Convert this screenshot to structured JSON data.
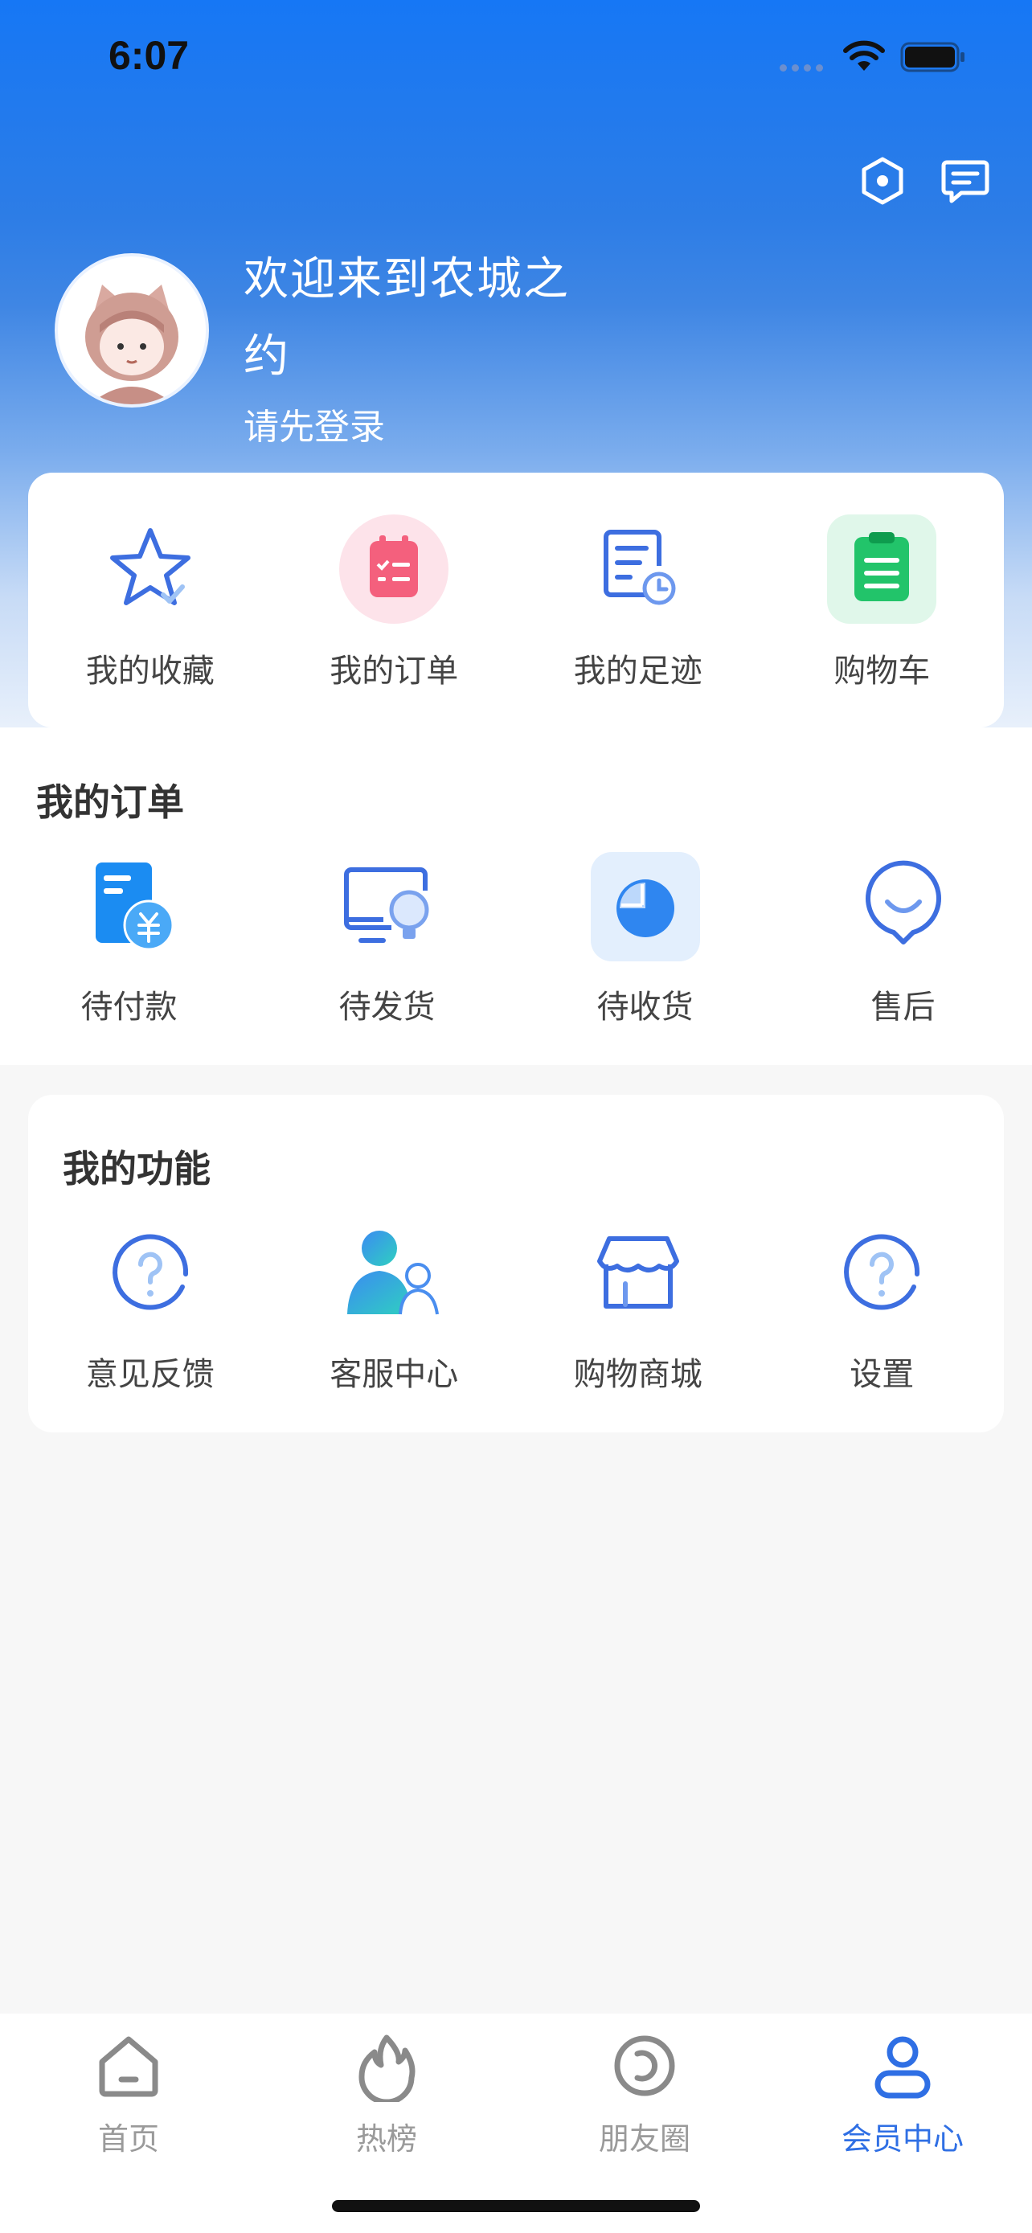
{
  "status_bar": {
    "time": "6:07"
  },
  "header": {
    "settings_icon": "hexagon-settings-icon",
    "message_icon": "message-icon",
    "welcome": "欢迎来到农城之约",
    "login_tip": "请先登录"
  },
  "quick_actions": [
    {
      "label": "我的收藏",
      "icon": "star-icon"
    },
    {
      "label": "我的订单",
      "icon": "order-list-icon"
    },
    {
      "label": "我的足迹",
      "icon": "footprint-icon"
    },
    {
      "label": "购物车",
      "icon": "clipboard-cart-icon"
    }
  ],
  "orders": {
    "title": "我的订单",
    "items": [
      {
        "label": "待付款",
        "icon": "payment-icon"
      },
      {
        "label": "待发货",
        "icon": "shipping-icon"
      },
      {
        "label": "待收货",
        "icon": "receive-icon"
      },
      {
        "label": "售后",
        "icon": "after-sales-icon"
      }
    ]
  },
  "functions": {
    "title": "我的功能",
    "items": [
      {
        "label": "意见反馈",
        "icon": "question-icon"
      },
      {
        "label": "客服中心",
        "icon": "customer-service-icon"
      },
      {
        "label": "购物商城",
        "icon": "store-icon"
      },
      {
        "label": "设置",
        "icon": "question-icon"
      }
    ]
  },
  "tabbar": {
    "items": [
      {
        "label": "首页",
        "icon": "home-icon"
      },
      {
        "label": "热榜",
        "icon": "flame-icon"
      },
      {
        "label": "朋友圈",
        "icon": "moments-icon"
      },
      {
        "label": "会员中心",
        "icon": "user-icon"
      }
    ],
    "active_index": 3
  },
  "colors": {
    "primary": "#2f6fe4",
    "header_top": "#1677f5",
    "inactive_tab": "#9a9a9a"
  }
}
